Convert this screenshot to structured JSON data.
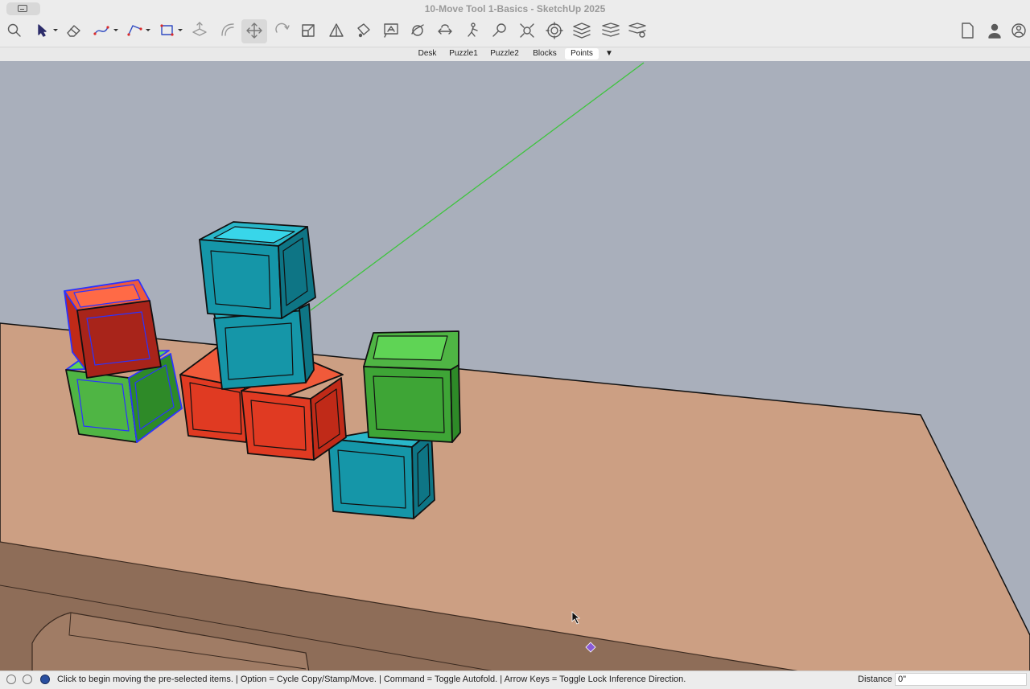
{
  "window": {
    "title": "10-Move Tool 1-Basics - SketchUp 2025"
  },
  "toolbar": {
    "tools": [
      {
        "name": "search-icon"
      },
      {
        "name": "select-tool-icon"
      },
      {
        "name": "eraser-icon"
      },
      {
        "name": "freehand-icon"
      },
      {
        "name": "line-tool-icon"
      },
      {
        "name": "rectangle-tool-icon"
      },
      {
        "name": "push-pull-icon"
      },
      {
        "name": "offset-icon"
      },
      {
        "name": "move-tool-icon"
      },
      {
        "name": "rotate-tool-icon"
      },
      {
        "name": "scale-tool-icon"
      },
      {
        "name": "tape-measure-icon"
      },
      {
        "name": "paint-bucket-icon"
      },
      {
        "name": "text-tool-icon"
      },
      {
        "name": "orbit-icon"
      },
      {
        "name": "pan-icon"
      },
      {
        "name": "walk-icon"
      },
      {
        "name": "zoom-icon"
      },
      {
        "name": "zoom-extents-icon"
      },
      {
        "name": "components-icon"
      },
      {
        "name": "styles-icon"
      },
      {
        "name": "layers-icon"
      },
      {
        "name": "scenes-icon"
      },
      {
        "name": "document-icon"
      },
      {
        "name": "user-icon"
      },
      {
        "name": "account-icon"
      }
    ]
  },
  "scenes": {
    "tabs": [
      "Desk",
      "Puzzle1",
      "Puzzle2",
      "Blocks",
      "Points"
    ],
    "active": "Points",
    "menu_glyph": "▼"
  },
  "colors": {
    "sky": "#a9afbb",
    "desk": "#cc9f83",
    "desk_edge": "#8e6d58",
    "block_red": "#e03a22",
    "block_green": "#4fb544",
    "block_cyan": "#1596a8",
    "selection": "#2b33ff",
    "axis_green": "#3ec43e"
  },
  "status": {
    "message": "Click to begin moving the pre-selected items. | Option = Cycle Copy/Stamp/Move. | Command = Toggle Autofold. | Arrow Keys = Toggle Lock Inference Direction.",
    "distance_label": "Distance",
    "distance_value": "0\""
  }
}
